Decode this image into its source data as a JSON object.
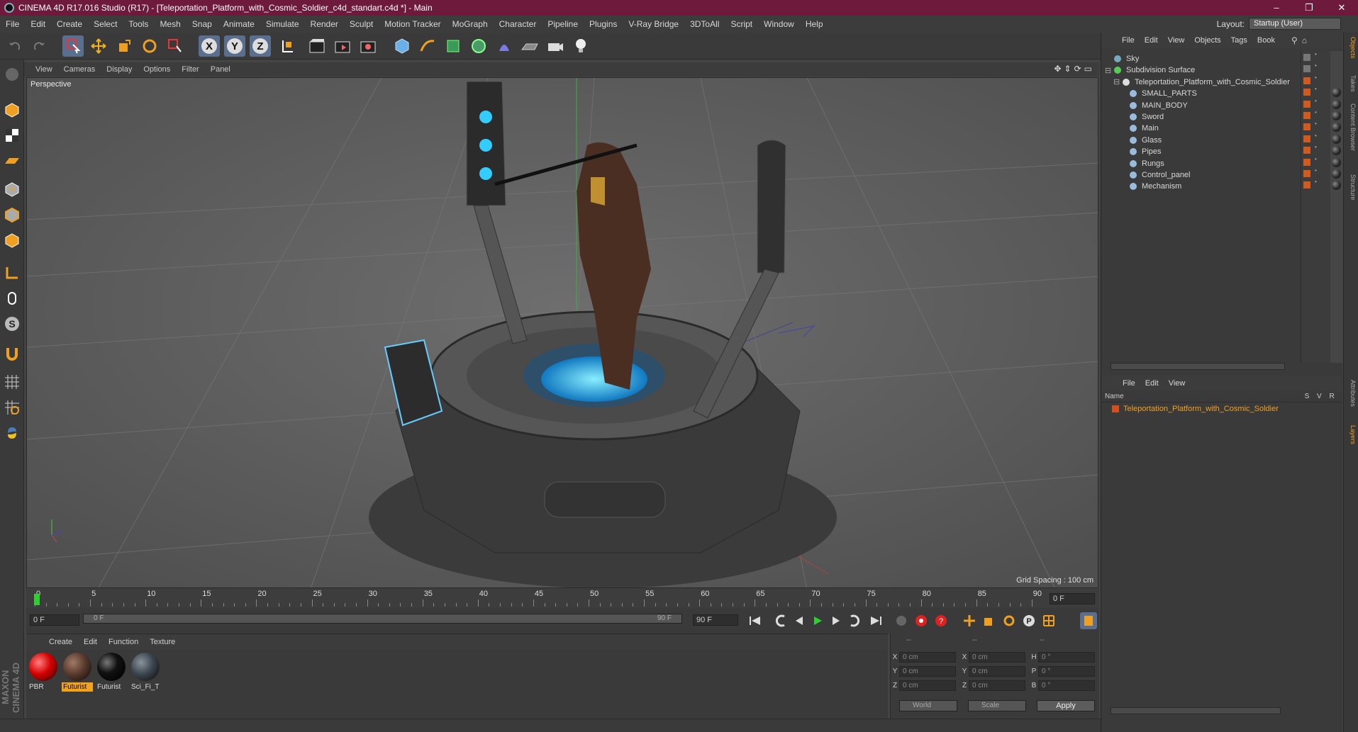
{
  "window": {
    "title": "CINEMA 4D R17.016 Studio (R17) - [Teleportation_Platform_with_Cosmic_Soldier_c4d_standart.c4d *] - Main",
    "min": "–",
    "max": "❐",
    "close": "✕"
  },
  "menubar": [
    "File",
    "Edit",
    "Create",
    "Select",
    "Tools",
    "Mesh",
    "Snap",
    "Animate",
    "Simulate",
    "Render",
    "Sculpt",
    "Motion Tracker",
    "MoGraph",
    "Character",
    "Pipeline",
    "Plugins",
    "V-Ray Bridge",
    "3DToAll",
    "Script",
    "Window",
    "Help"
  ],
  "layout": {
    "label": "Layout:",
    "value": "Startup (User)"
  },
  "viewport": {
    "menu": [
      "View",
      "Cameras",
      "Display",
      "Options",
      "Filter",
      "Panel"
    ],
    "label": "Perspective",
    "grid_spacing": "Grid Spacing : 100 cm"
  },
  "timeline": {
    "ticks": [
      "0",
      "5",
      "10",
      "15",
      "20",
      "25",
      "30",
      "35",
      "40",
      "45",
      "50",
      "55",
      "60",
      "65",
      "70",
      "75",
      "80",
      "85",
      "90"
    ],
    "current_frame": "0 F",
    "start": "0 F",
    "slider_start": "0 F",
    "slider_end": "90 F",
    "end": "90 F"
  },
  "material_manager": {
    "menu": [
      "Create",
      "Edit",
      "Function",
      "Texture"
    ],
    "materials": [
      {
        "name": "PBR",
        "color": "#d40000"
      },
      {
        "name": "Futurist",
        "color": "#5a3b2e"
      },
      {
        "name": "Futurist",
        "color": "#111111"
      },
      {
        "name": "Sci_Fi_T",
        "color": "#3c4650"
      }
    ]
  },
  "coords": {
    "rows": [
      {
        "a": "X",
        "av": "0 cm",
        "b": "X",
        "bv": "0 cm",
        "c": "H",
        "cv": "0 °"
      },
      {
        "a": "Y",
        "av": "0 cm",
        "b": "Y",
        "bv": "0 cm",
        "c": "P",
        "cv": "0 °"
      },
      {
        "a": "Z",
        "av": "0 cm",
        "b": "Z",
        "bv": "0 cm",
        "c": "B",
        "cv": "0 °"
      }
    ],
    "dash1": "--",
    "dash2": "--",
    "dash3": "--",
    "world": "World",
    "scale": "Scale",
    "apply": "Apply"
  },
  "object_manager": {
    "menu": [
      "File",
      "Edit",
      "View",
      "Objects",
      "Tags",
      "Book"
    ],
    "objects": [
      {
        "name": "Sky",
        "level": 0
      },
      {
        "name": "Subdivision Surface",
        "level": 0
      },
      {
        "name": "Teleportation_Platform_with_Cosmic_Soldier",
        "level": 1
      },
      {
        "name": "SMALL_PARTS",
        "level": 2
      },
      {
        "name": "MAIN_BODY",
        "level": 2
      },
      {
        "name": "Sword",
        "level": 2
      },
      {
        "name": "Main",
        "level": 2
      },
      {
        "name": "Glass",
        "level": 2
      },
      {
        "name": "Pipes",
        "level": 2
      },
      {
        "name": "Rungs",
        "level": 2
      },
      {
        "name": "Control_panel",
        "level": 2
      },
      {
        "name": "Mechanism",
        "level": 2
      }
    ]
  },
  "layer_manager": {
    "menu": [
      "File",
      "Edit",
      "View"
    ],
    "header": {
      "name": "Name",
      "s": "S",
      "v": "V",
      "r": "R"
    },
    "layer": "Teleportation_Platform_with_Cosmic_Soldier"
  },
  "side_tabs": [
    "Objects",
    "Takes",
    "Content Browser",
    "Structure",
    "Attributes",
    "Layers"
  ],
  "brand": "MAXON CINEMA 4D"
}
